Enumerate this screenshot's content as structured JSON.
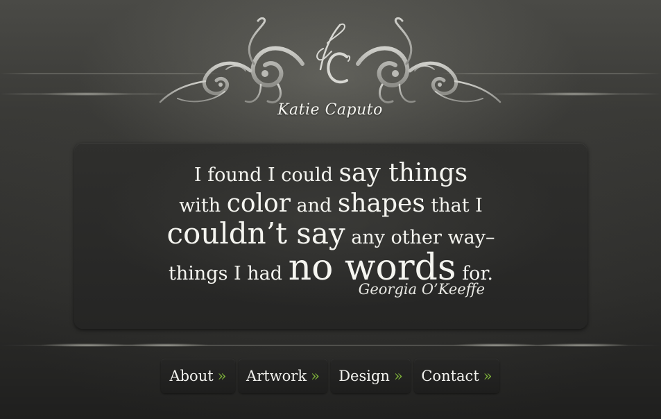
{
  "header": {
    "monogram_label": "kC",
    "brand_name": "Katie Caputo"
  },
  "quote": {
    "line1": [
      {
        "text": "I found I could ",
        "size": "s-sm"
      },
      {
        "text": "say things",
        "size": "s-md"
      }
    ],
    "line2": [
      {
        "text": "with ",
        "size": "s-sm"
      },
      {
        "text": "color",
        "size": "s-md"
      },
      {
        "text": " and ",
        "size": "s-sm"
      },
      {
        "text": "shapes",
        "size": "s-md"
      },
      {
        "text": " that I",
        "size": "s-sm"
      }
    ],
    "line3": [
      {
        "text": "couldn’t say",
        "size": "s-lg"
      },
      {
        "text": " any other way–",
        "size": "s-sm"
      }
    ],
    "line4": [
      {
        "text": "things I had ",
        "size": "s-sm"
      },
      {
        "text": "no words",
        "size": "s-xl"
      },
      {
        "text": " for.",
        "size": "s-sm"
      }
    ],
    "author": "Georgia O’Keeffe"
  },
  "nav": {
    "items": [
      {
        "label": "About",
        "arrow": "»"
      },
      {
        "label": "Artwork",
        "arrow": "»"
      },
      {
        "label": "Design",
        "arrow": "»"
      },
      {
        "label": "Contact",
        "arrow": "»"
      }
    ]
  },
  "colors": {
    "accent_arrow": "#7fb43a",
    "text": "#f2f2ee",
    "panel": "#2a2a28",
    "background": "#3a3a37"
  },
  "icons": {
    "emblem": "ornate-flourish-icon",
    "monogram": "kc-monogram-icon"
  }
}
